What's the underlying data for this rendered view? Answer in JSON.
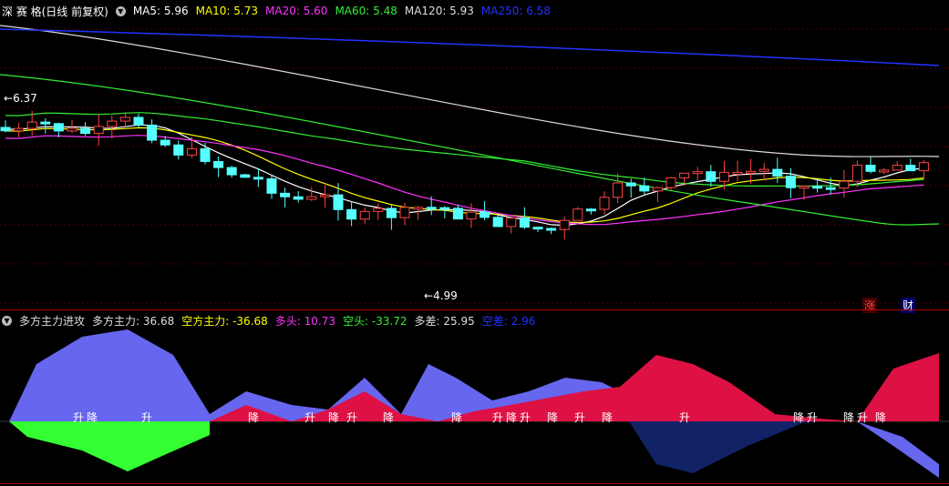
{
  "main_panel": {
    "stock_name": "深 赛 格(日线 前复权)",
    "ma_items": [
      {
        "label": "MA5: 5.96",
        "color": "#ffffff"
      },
      {
        "label": "MA10: 5.73",
        "color": "#ffff00"
      },
      {
        "label": "MA20: 5.60",
        "color": "#ff33ff"
      },
      {
        "label": "MA60: 5.48",
        "color": "#33ee33"
      },
      {
        "label": "MA120: 5.93",
        "color": "#dddddd"
      },
      {
        "label": "MA250: 6.58",
        "color": "#2233ff"
      }
    ],
    "high_marker": "6.37",
    "low_marker": "4.99",
    "badges": [
      "涨",
      "财"
    ]
  },
  "sub_panel": {
    "title": "多方主力进攻",
    "items": [
      {
        "label": "多方主力: 36.68",
        "color": "#dddddd"
      },
      {
        "label": "空方主力: -36.68",
        "color": "#ffff00"
      },
      {
        "label": "多头: 10.73",
        "color": "#ff33ff"
      },
      {
        "label": "空头: -33.72",
        "color": "#33ee33"
      },
      {
        "label": "多差: 25.95",
        "color": "#dddddd"
      },
      {
        "label": "空差: 2.96",
        "color": "#2233ff"
      }
    ],
    "signals": [
      "升",
      "降",
      "升",
      "降",
      "升",
      "降",
      "升",
      "降",
      "降",
      "升",
      "降",
      "升",
      "降",
      "升",
      "降",
      "升",
      "降",
      "升",
      "降",
      "升",
      "降"
    ]
  },
  "chart_data": {
    "type": "candlestick",
    "overlays": [
      "MA5",
      "MA10",
      "MA20",
      "MA60",
      "MA120",
      "MA250"
    ],
    "annotated_high": 6.37,
    "annotated_low": 4.99
  }
}
